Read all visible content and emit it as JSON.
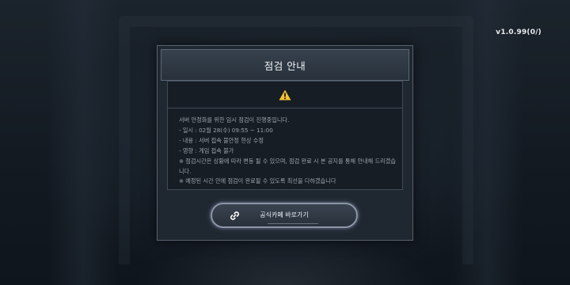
{
  "version": "v1.0.99(0/)",
  "popup": {
    "title": "점검 안내",
    "warning_icon": "warning-triangle-icon",
    "warning_color": "#f2c230",
    "lines": [
      "서버 안정화를 위한 임시 점검이 진행중입니다.",
      "- 일시 : 02월 28(수) 09:55 ~ 11:00",
      "- 내용 : 서버 접속 불안정 현상 수정",
      "- 영향 : 게임 접속 불가",
      "※ 점검시간은 상황에 따라 변동 될 수 있으며, 점검 완료 시 본 공지를 통해 안내해 드리겠습니다.",
      "※ 예정된 시간 안에 점검이 완료될 수 있도록 최선을 다하겠습니다"
    ]
  },
  "cafe_button": {
    "label": "공식카페 바로가기",
    "icon": "link-icon"
  }
}
